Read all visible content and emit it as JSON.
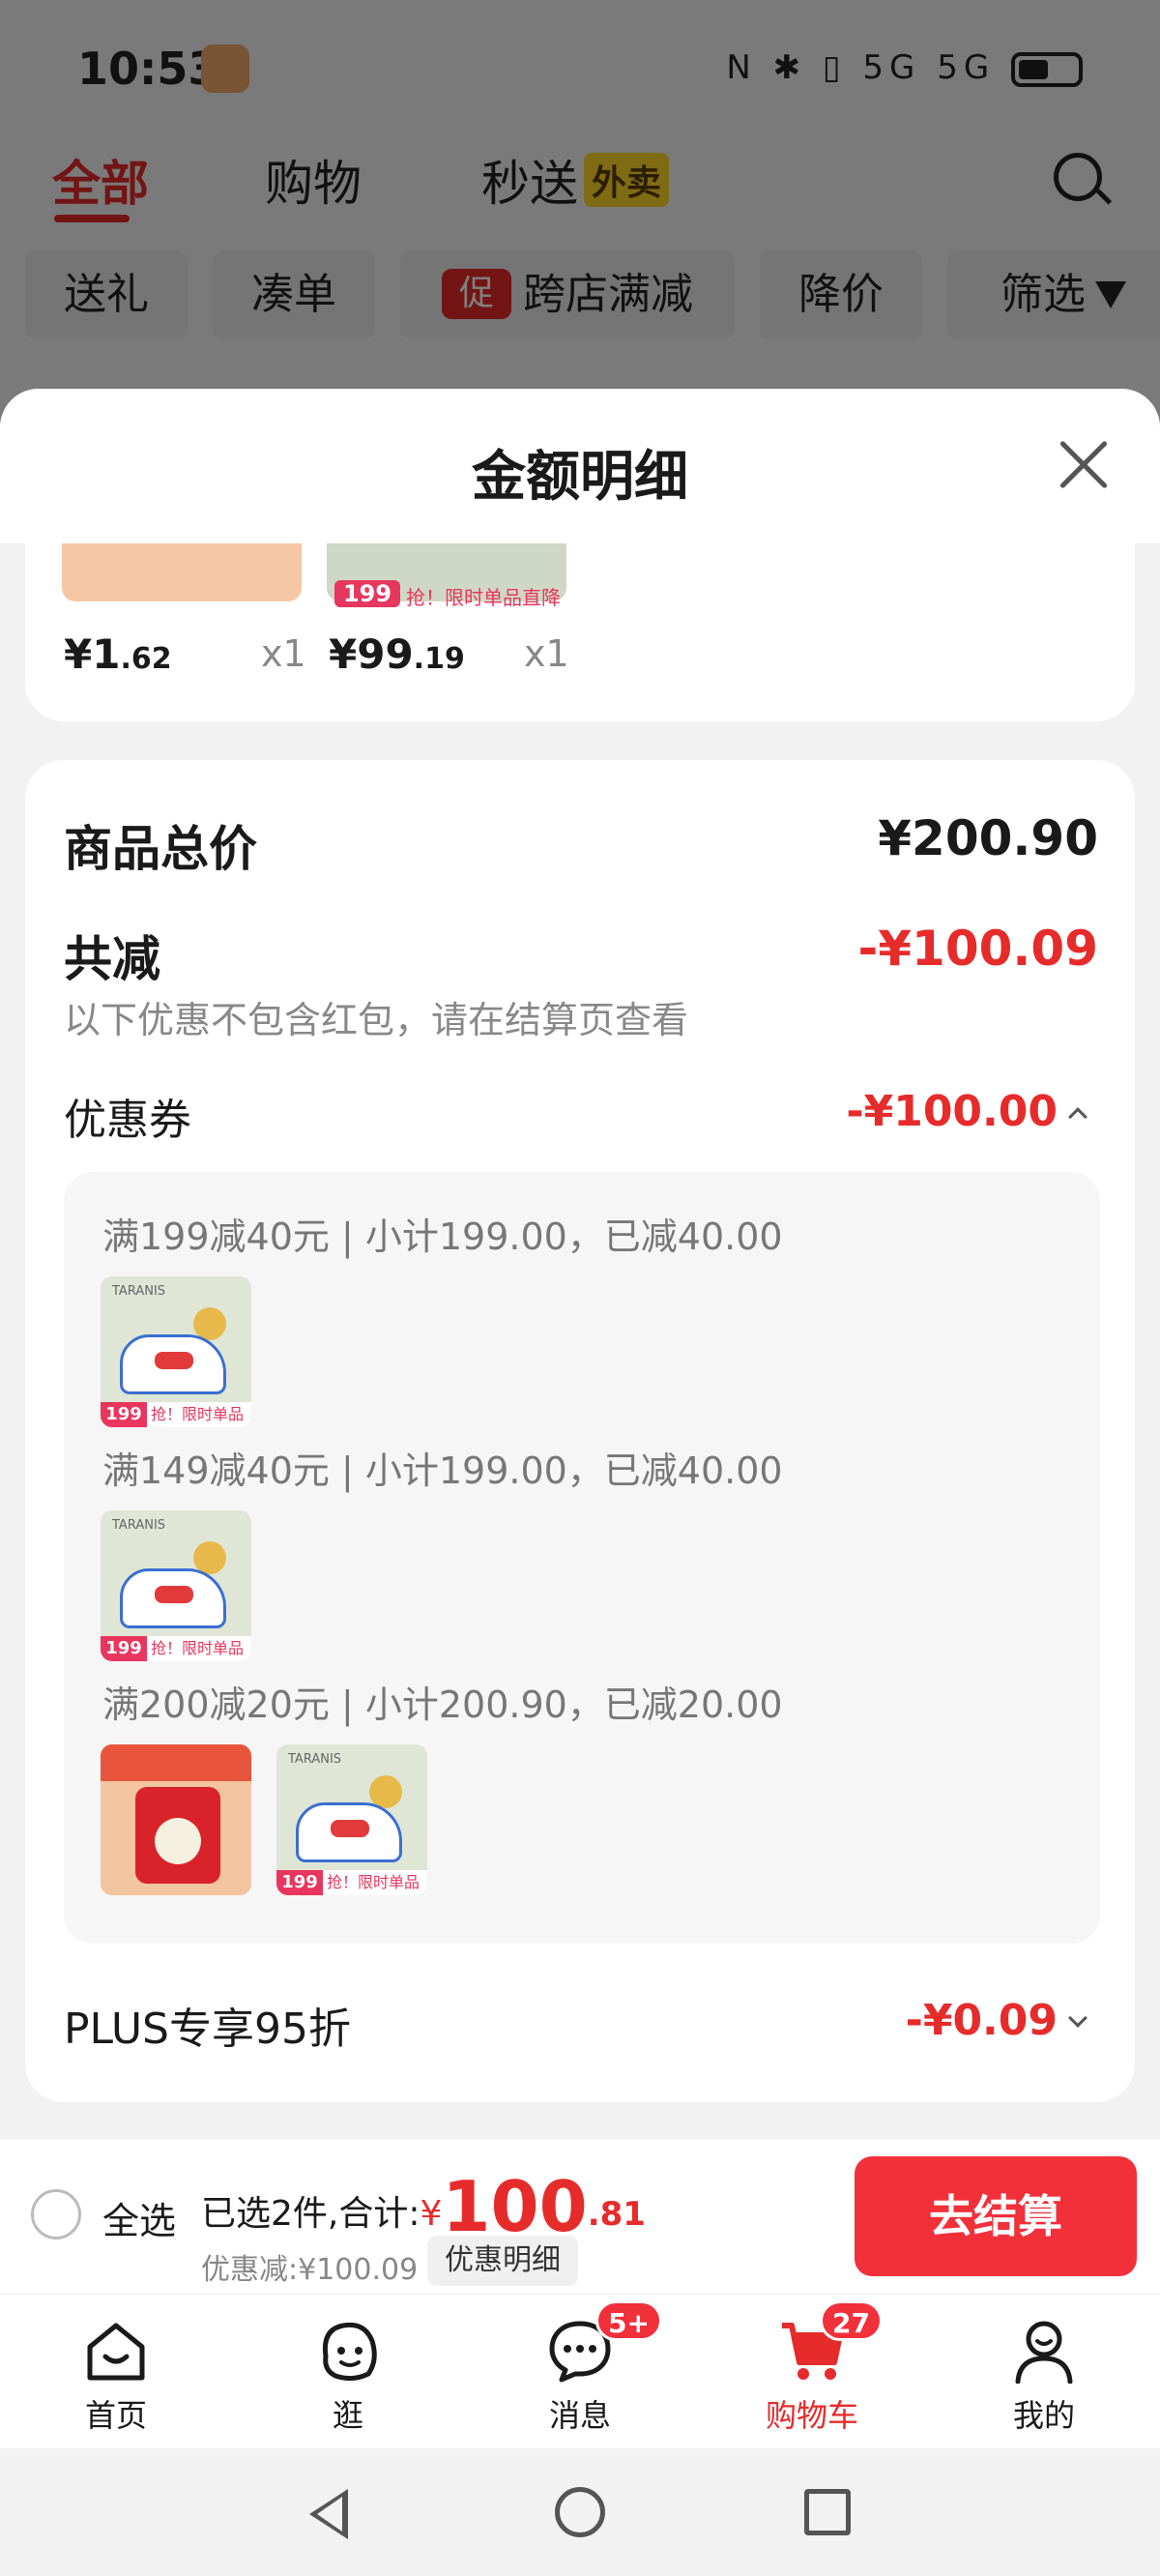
{
  "status_bar": {
    "time": "10:53",
    "icons_text": "N ✱ ▯ 5G 5G"
  },
  "top_tabs": [
    {
      "label": "全部",
      "active": true
    },
    {
      "label": "购物",
      "active": false
    },
    {
      "label": "秒送",
      "badge": "外卖",
      "active": false
    }
  ],
  "filters": [
    {
      "label": "送礼"
    },
    {
      "label": "凑单"
    },
    {
      "label": "跨店满减",
      "promo": "促"
    },
    {
      "label": "降价"
    },
    {
      "label": "筛选"
    }
  ],
  "sheet": {
    "title": "金额明细",
    "items": [
      {
        "price_int": "¥1",
        "price_dec": ".62",
        "qty": "x1"
      },
      {
        "price_int": "¥99",
        "price_dec": ".19",
        "qty": "x1",
        "tag_price": "199",
        "tag_text": "抢！限时单品直降"
      }
    ],
    "total_label": "商品总价",
    "total_value": "¥200.90",
    "discount_label": "共减",
    "discount_value": "-¥100.09",
    "discount_note": "以下优惠不包含红包，请在结算页查看",
    "coupon_label": "优惠券",
    "coupon_value": "-¥100.00",
    "coupon_rules": [
      {
        "text": "满199减40元 | 小计199.00，已减40.00"
      },
      {
        "text": "满149减40元 | 小计199.00，已减40.00"
      },
      {
        "text": "满200减20元 | 小计200.90，已减20.00"
      }
    ],
    "thumb_tag_price": "199",
    "thumb_tag_text": "抢！限时单品直降",
    "thumb_brand": "TARANIS",
    "plus_label": "PLUS专享95折",
    "plus_value": "-¥0.09"
  },
  "checkout": {
    "select_all": "全选",
    "selected_text": "已选2件,合计:",
    "yen": "¥",
    "total_int": "100",
    "total_dec": ".81",
    "discount_text": "优惠减:¥100.09",
    "detail_button": "优惠明细",
    "checkout_button": "去结算"
  },
  "tabbar": [
    {
      "label": "首页",
      "icon": "home-icon"
    },
    {
      "label": "逛",
      "icon": "browse-icon"
    },
    {
      "label": "消息",
      "icon": "message-icon",
      "badge": "5+"
    },
    {
      "label": "购物车",
      "icon": "cart-icon",
      "badge": "27",
      "active": true
    },
    {
      "label": "我的",
      "icon": "profile-icon"
    }
  ],
  "colors": {
    "accent": "#e62b2b",
    "button": "#f2303a"
  }
}
